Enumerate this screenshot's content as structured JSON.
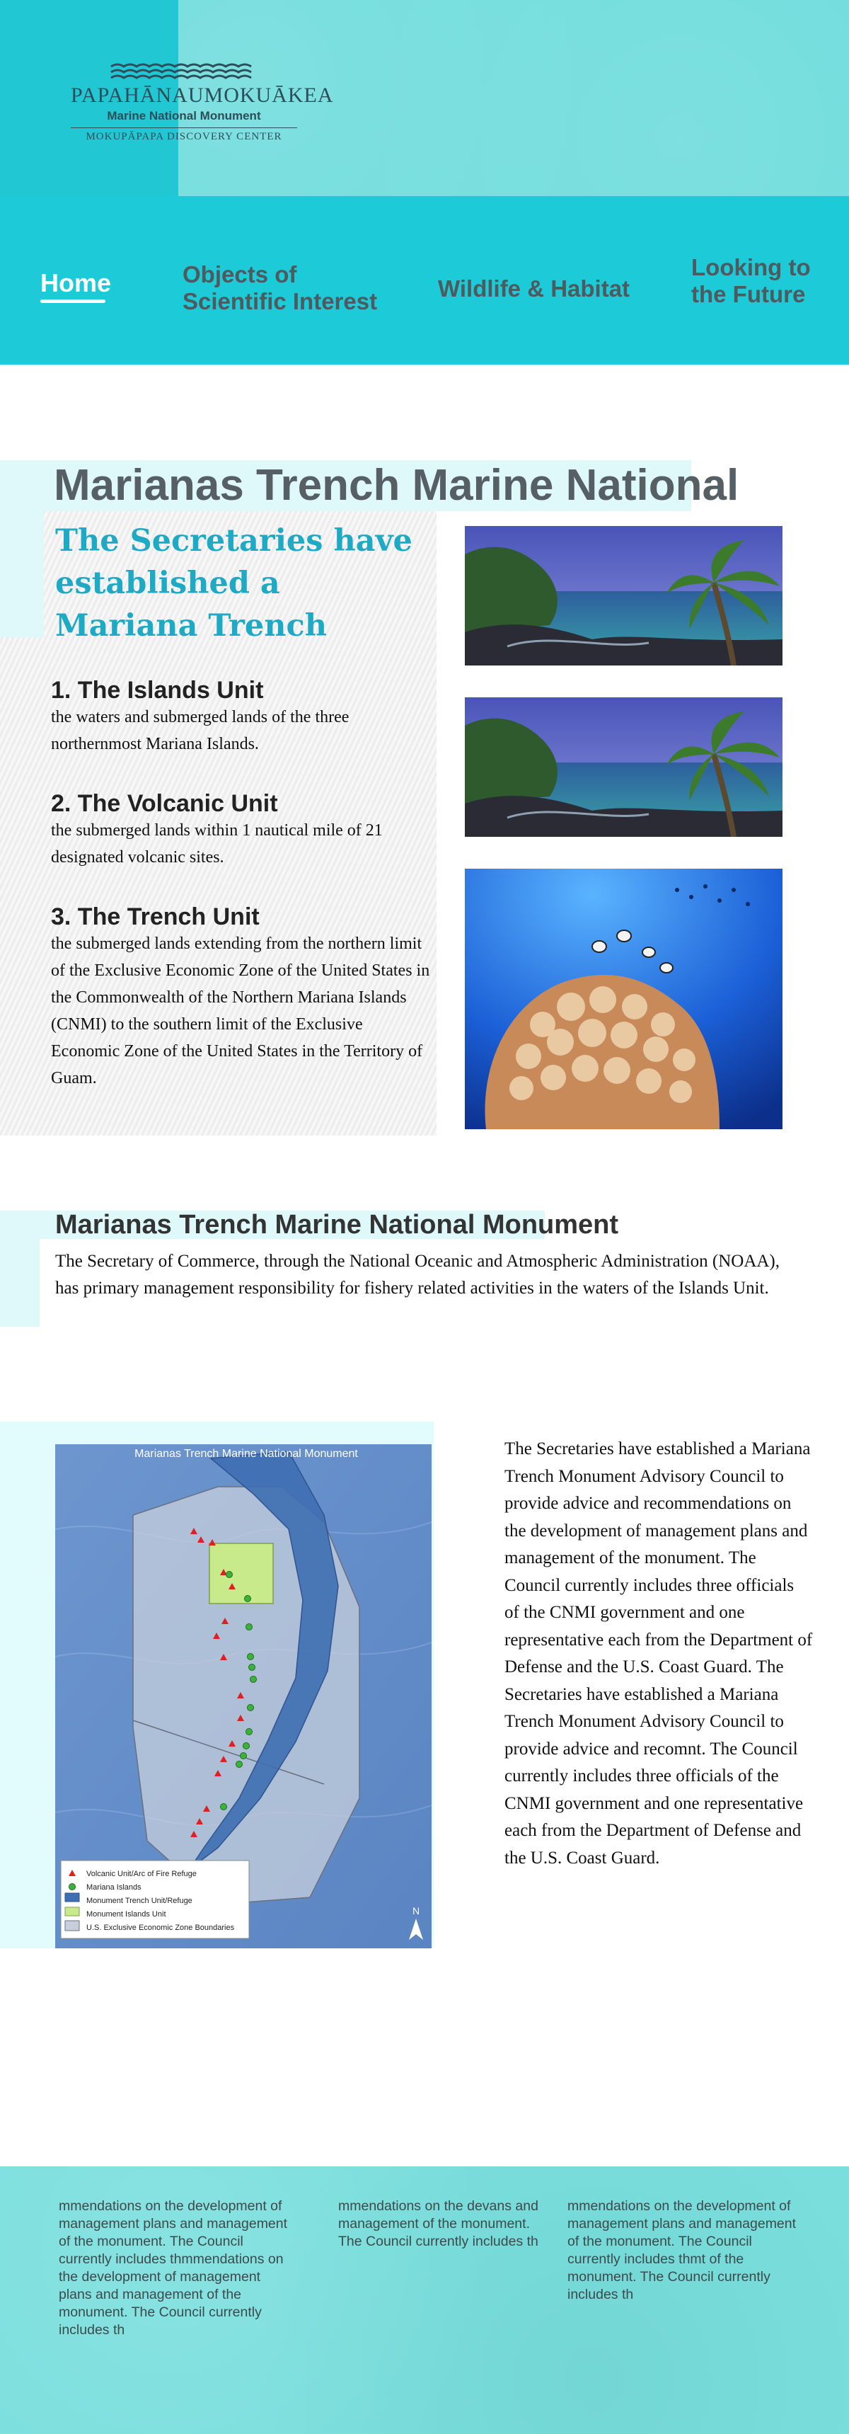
{
  "header": {
    "logo": {
      "name": "PAPAHĀNAUMOKUĀKEA",
      "subtitle": "Marine National Monument",
      "center": "MOKUPĀPAPA DISCOVERY CENTER"
    },
    "nav": [
      {
        "label": "Home",
        "active": true
      },
      {
        "label": "Objects of Scientific Interest"
      },
      {
        "label": "Wildlife & Habitat"
      },
      {
        "label": "Looking to the Future"
      }
    ]
  },
  "section1": {
    "title": "Marianas Trench Marine National",
    "subtitle": "The Secretaries have established a Mariana Trench",
    "units": [
      {
        "heading": "1. The Islands Unit",
        "text": "the waters and submerged lands of the three northernmost Mariana Islands."
      },
      {
        "heading": "2. The Volcanic Unit",
        "text": "the submerged lands within 1 nautical mile of 21 designated volcanic sites."
      },
      {
        "heading": "3. The Trench Unit",
        "text": "the submerged lands extending from the northern limit of the Exclusive Economic Zone of the United States in the Commonwealth of the Northern Mariana Islands (CNMI) to the southern limit of the Exclusive Economic Zone of the United States in the Territory of Guam."
      }
    ]
  },
  "section2": {
    "title": "Marianas Trench Marine National Monument",
    "text": "The Secretary of Commerce, through the National Oceanic and Atmospheric Administration (NOAA), has primary management responsibility for fishery related activities in the waters of the Islands Unit."
  },
  "section3": {
    "map": {
      "title": "Marianas Trench Marine National Monument",
      "legend": [
        "Volcanic Unit/Arc of Fire Refuge",
        "Mariana Islands",
        "Monument Trench Unit/Refuge",
        "Monument Islands Unit",
        "U.S. Exclusive Economic Zone Boundaries"
      ],
      "north": "N"
    },
    "text": "The Secretaries have established a Mariana Trench Monument Advisory Council to provide advice and recommendations on the development of management plans and management of the monument. The Council currently includes three officials of the CNMI government and one representative each from the Department of Defense and the U.S. Coast Guard. The Secretaries have established a Mariana Trench Monument Advisory Council to provide advice and recomnt. The Council currently includes three officials of the CNMI government and one representative each from the Department of Defense and the U.S. Coast Guard."
  },
  "footer": {
    "columns": [
      "mmendations on the development of management plans and management of the monument. The Council currently includes thmmendations on the development of management plans and management of the monument. The Council currently includes th",
      "mmendations on the devans and management of the monument. The Council currently includes th",
      "mmendations on the development of management plans and management of the monument. The Council currently includes thmt of the monument. The Council currently includes th"
    ]
  }
}
